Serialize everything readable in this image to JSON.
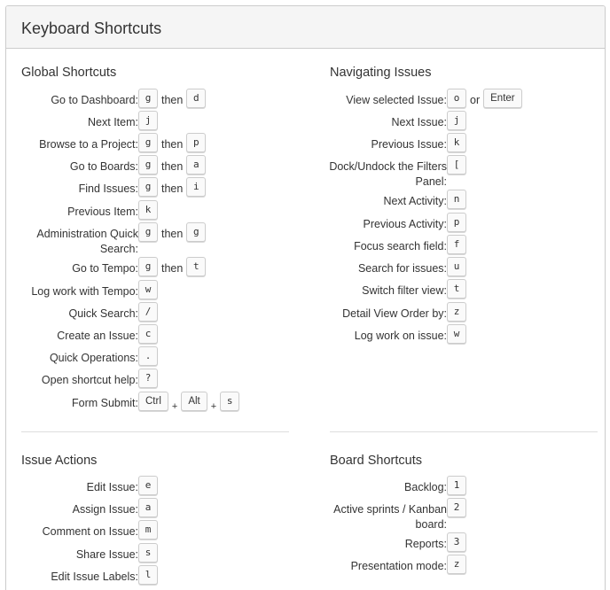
{
  "dialog": {
    "title": "Keyboard Shortcuts"
  },
  "global": {
    "title": "Global Shortcuts",
    "rows": [
      {
        "label": "Go to Dashboard:",
        "keys": [
          "g",
          "then",
          "d"
        ]
      },
      {
        "label": "Next Item:",
        "keys": [
          "j"
        ]
      },
      {
        "label": "Browse to a Project:",
        "keys": [
          "g",
          "then",
          "p"
        ]
      },
      {
        "label": "Go to Boards:",
        "keys": [
          "g",
          "then",
          "a"
        ]
      },
      {
        "label": "Find Issues:",
        "keys": [
          "g",
          "then",
          "i"
        ]
      },
      {
        "label": "Previous Item:",
        "keys": [
          "k"
        ]
      },
      {
        "label": "Administration Quick Search:",
        "keys": [
          "g",
          "then",
          "g"
        ]
      },
      {
        "label": "Go to Tempo:",
        "keys": [
          "g",
          "then",
          "t"
        ]
      },
      {
        "label": "Log work with Tempo:",
        "keys": [
          "w"
        ]
      },
      {
        "label": "Quick Search:",
        "keys": [
          "/"
        ]
      },
      {
        "label": "Create an Issue:",
        "keys": [
          "c"
        ]
      },
      {
        "label": "Quick Operations:",
        "keys": [
          "."
        ]
      },
      {
        "label": "Open shortcut help:",
        "keys": [
          "?"
        ]
      },
      {
        "label": "Form Submit:",
        "keys": [
          "Ctrl",
          "+",
          "Alt",
          "+",
          "s"
        ]
      }
    ]
  },
  "navigating": {
    "title": "Navigating Issues",
    "rows": [
      {
        "label": "View selected Issue:",
        "keys": [
          "o",
          "or",
          "Enter"
        ]
      },
      {
        "label": "Next Issue:",
        "keys": [
          "j"
        ]
      },
      {
        "label": "Previous Issue:",
        "keys": [
          "k"
        ]
      },
      {
        "label": "Dock/Undock the Filters Panel:",
        "keys": [
          "["
        ]
      },
      {
        "label": "Next Activity:",
        "keys": [
          "n"
        ]
      },
      {
        "label": "Previous Activity:",
        "keys": [
          "p"
        ]
      },
      {
        "label": "Focus search field:",
        "keys": [
          "f"
        ]
      },
      {
        "label": "Search for issues:",
        "keys": [
          "u"
        ]
      },
      {
        "label": "Switch filter view:",
        "keys": [
          "t"
        ]
      },
      {
        "label": "Detail View Order by:",
        "keys": [
          "z"
        ]
      },
      {
        "label": "Log work on issue:",
        "keys": [
          "w"
        ]
      }
    ]
  },
  "issue_actions": {
    "title": "Issue Actions",
    "rows": [
      {
        "label": "Edit Issue:",
        "keys": [
          "e"
        ]
      },
      {
        "label": "Assign Issue:",
        "keys": [
          "a"
        ]
      },
      {
        "label": "Comment on Issue:",
        "keys": [
          "m"
        ]
      },
      {
        "label": "Share Issue:",
        "keys": [
          "s"
        ]
      },
      {
        "label": "Edit Issue Labels:",
        "keys": [
          "l"
        ]
      }
    ]
  },
  "board": {
    "title": "Board Shortcuts",
    "rows": [
      {
        "label": "Backlog:",
        "keys": [
          "1"
        ]
      },
      {
        "label": "Active sprints / Kanban board:",
        "keys": [
          "2"
        ]
      },
      {
        "label": "Reports:",
        "keys": [
          "3"
        ]
      },
      {
        "label": "Presentation mode:",
        "keys": [
          "z"
        ]
      }
    ]
  }
}
